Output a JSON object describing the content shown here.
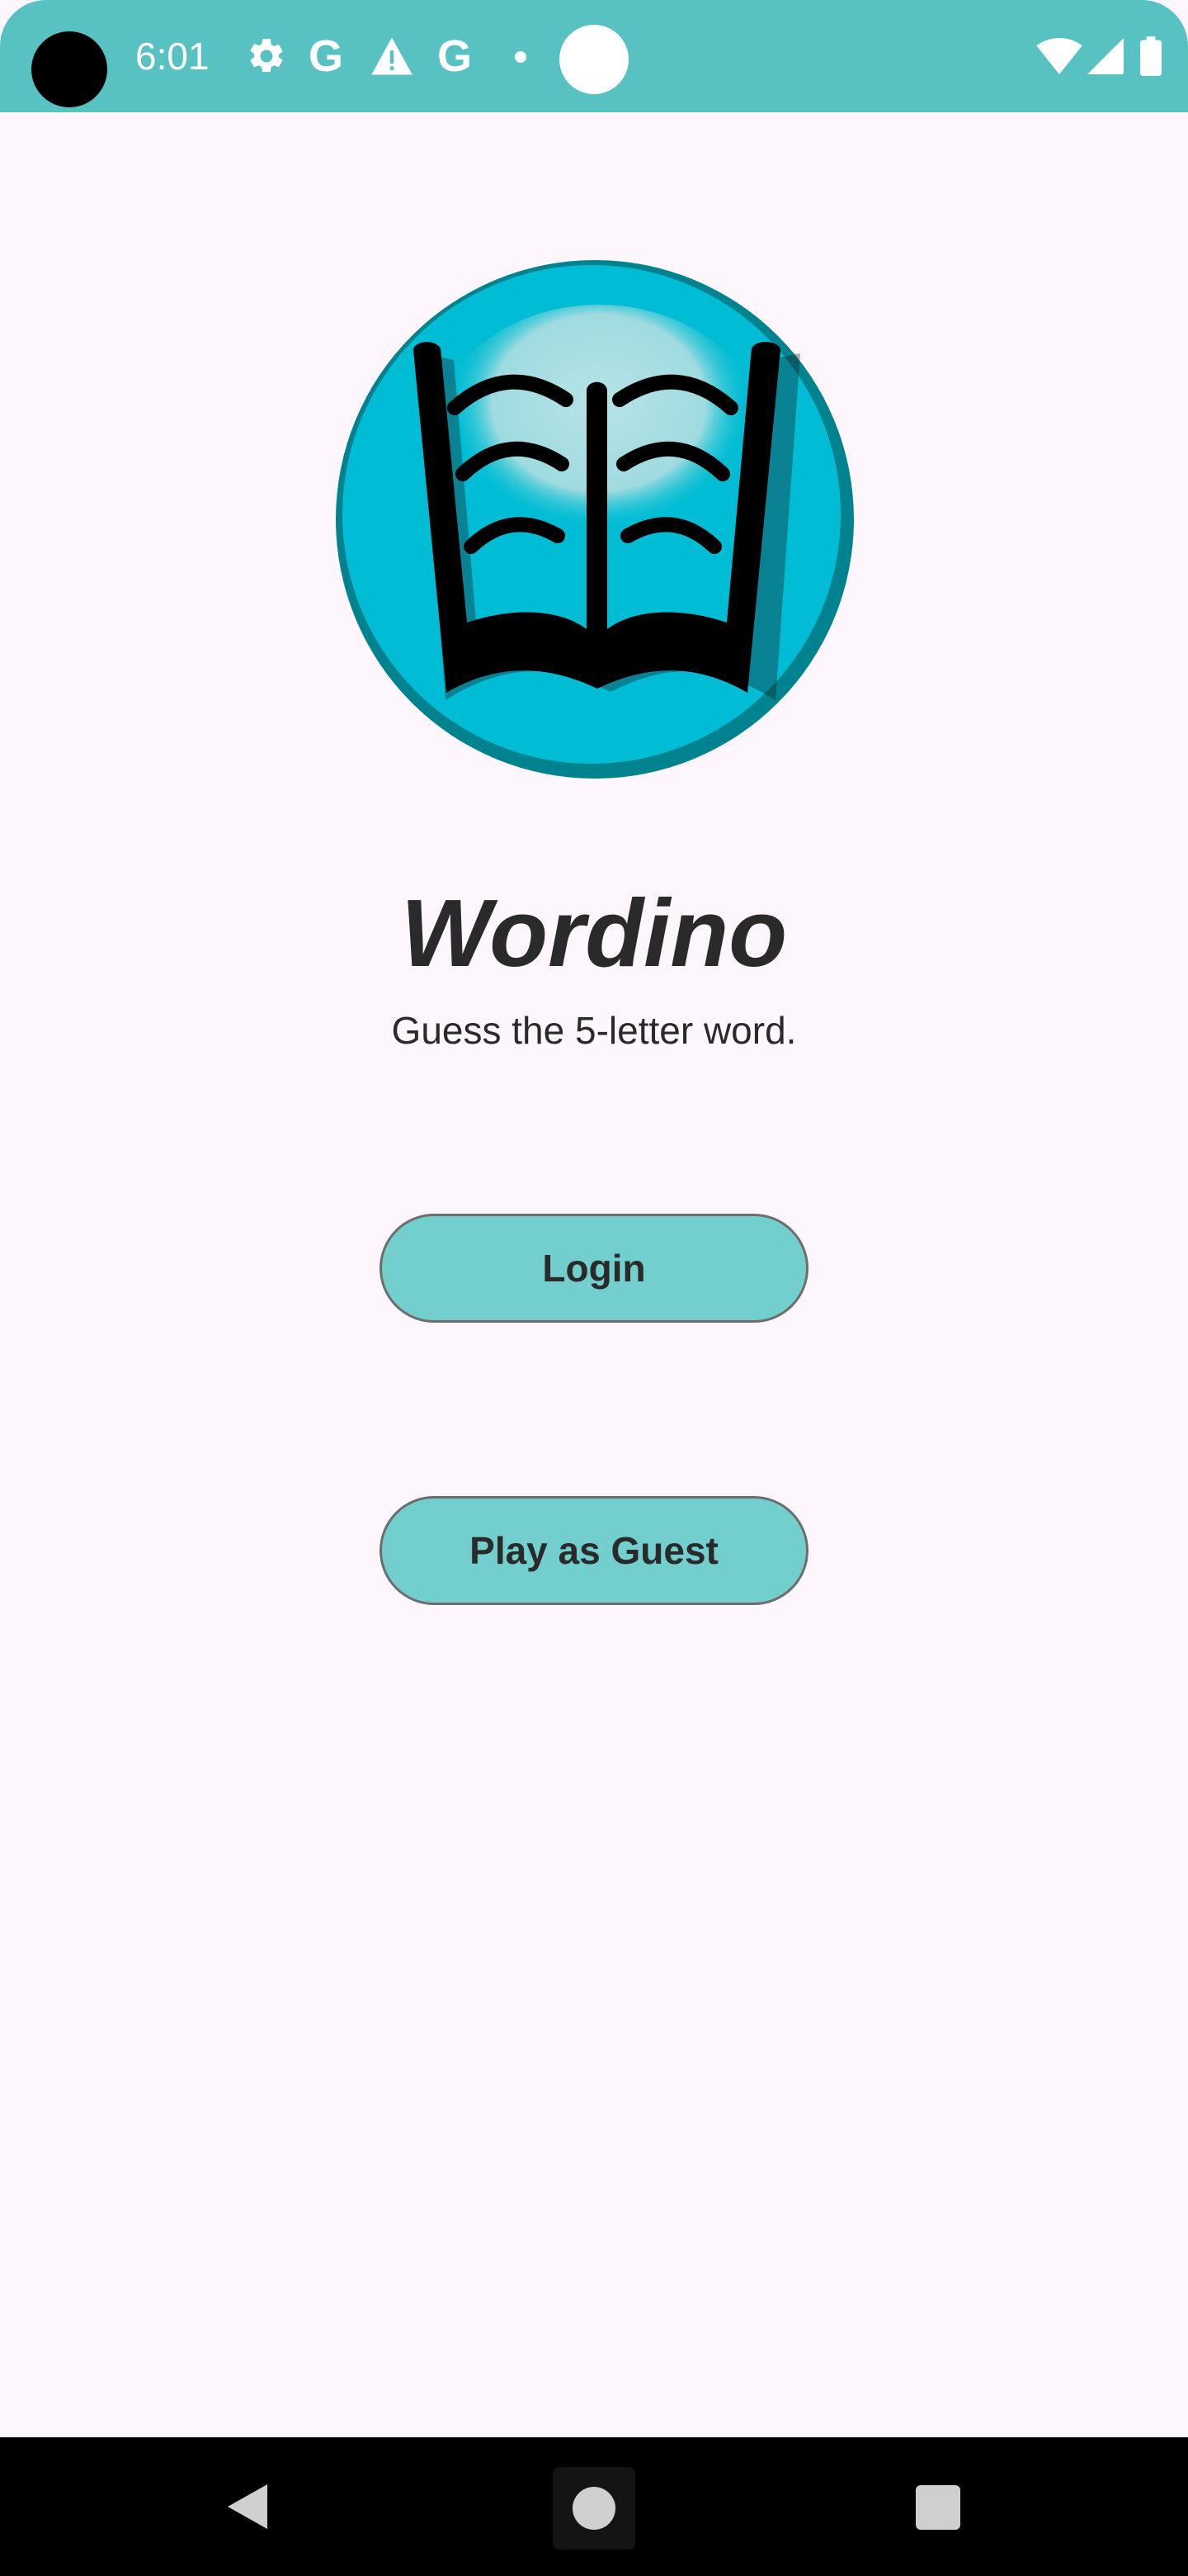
{
  "status_bar": {
    "time": "6:01",
    "icons": [
      "settings-icon",
      "google-icon",
      "warning-icon",
      "google-icon",
      "notification-dot-icon",
      "circle-icon",
      "wifi-icon",
      "cellular-icon",
      "battery-icon"
    ],
    "g_letter": "G",
    "background_color": "#58c1c1"
  },
  "app": {
    "logo": "book-logo",
    "title": "Wordino",
    "subtitle": "Guess the 5-letter word."
  },
  "actions": {
    "login_label": "Login",
    "guest_label": "Play as Guest",
    "button_color": "#72cfcd"
  },
  "nav_bar": {
    "items": [
      "back-icon",
      "home-icon",
      "recents-icon"
    ]
  }
}
